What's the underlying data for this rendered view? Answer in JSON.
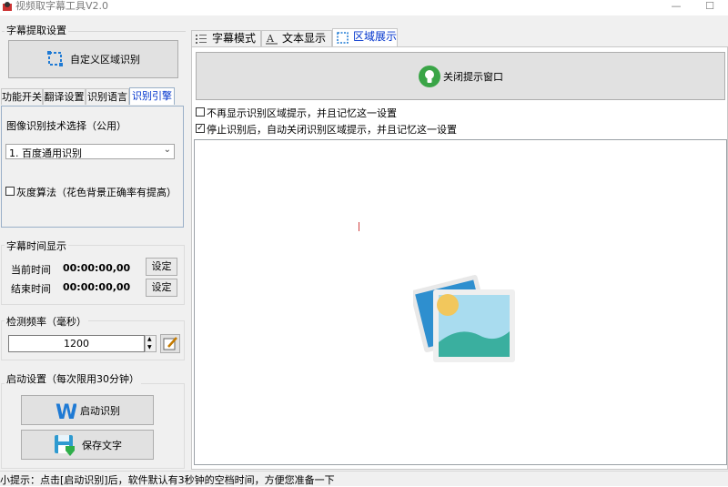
{
  "window": {
    "title": "视频取字幕工具V2.0",
    "minimize_glyph": "—",
    "maximize_glyph": "☐"
  },
  "left": {
    "extract_section_title": "字幕提取设置",
    "custom_region_button": "自定义区域识别",
    "subtabs": [
      "功能开关",
      "翻译设置",
      "识别语言",
      "识别引擎"
    ],
    "engine_label": "图像识别技术选择（公用）",
    "engine_select_value": "1. 百度通用识别",
    "gray_algo_label": "灰度算法（花色背景正确率有提高）",
    "time_section_title": "字幕时间显示",
    "current_time_label": "当前时间",
    "current_time_value": "00:00:00,00",
    "end_time_label": "结束时间",
    "end_time_value": "00:00:00,00",
    "set_button": "设定",
    "freq_section_title": "检测频率（毫秒）",
    "freq_value": "1200",
    "start_section_title": "启动设置（每次限用30分钟）",
    "start_button": "启动识别",
    "save_button": "保存文字"
  },
  "right": {
    "tabs": [
      "字幕模式",
      "文本显示",
      "区域展示"
    ],
    "close_prompt_button": "关闭提示窗口",
    "no_show_label": "不再显示识别区域提示，并且记忆这一设置",
    "auto_close_label": "停止识别后，自动关闭识别区域提示，并且记忆这一设置",
    "no_show_checked": false,
    "auto_close_checked": true
  },
  "status_text": "小提示：点击[启动识别]后，软件默认有3秒钟的空档时间，方便您准备一下",
  "colors": {
    "accent_blue": "#0033cc",
    "word_icon_blue": "#1f7ad4",
    "bulb_green": "#4caf50",
    "image_teal": "#3aaf9f",
    "image_sky": "#a9dcef",
    "image_sun": "#f2c75c"
  }
}
